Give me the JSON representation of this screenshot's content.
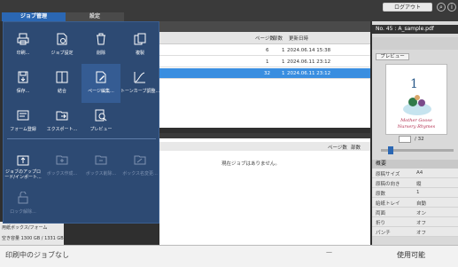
{
  "header": {
    "tabs": [
      {
        "label": "ジョブ管理"
      },
      {
        "label": "設定"
      }
    ],
    "logout_label": "ログアウト"
  },
  "job_list": {
    "columns": [
      "ページ数",
      "部数",
      "更新日時"
    ],
    "rows": [
      {
        "pages": "6",
        "copies": "1",
        "updated": "2024.06.14 15:38",
        "selected": false
      },
      {
        "pages": "1",
        "copies": "1",
        "updated": "2024.06.11 23:12",
        "selected": false
      },
      {
        "pages": "32",
        "copies": "1",
        "updated": "2024.06.11 23:12",
        "selected": true
      }
    ]
  },
  "queue": {
    "columns": [
      "ページ数",
      "部数"
    ],
    "empty_message": "現在ジョブはありません。"
  },
  "left_info": {
    "folder": "用紙ボックス/フォーム",
    "capacity": "空き容量 1300 GB / 1331 GB"
  },
  "preview": {
    "title": "No. 45 : A_sample.pdf",
    "preview_button": "プレビュー",
    "page_current": "",
    "page_total": "/ 32",
    "book_title_line1": "Mother Goose",
    "book_title_line2": "Nursery Rhymes",
    "book_page_no": "1"
  },
  "summary": {
    "header": "概要",
    "rows": [
      {
        "key": "原稿サイズ",
        "value": "A4"
      },
      {
        "key": "原稿の向き",
        "value": "縦"
      },
      {
        "key": "原数",
        "value": "1"
      },
      {
        "key": "給紙トレイ",
        "value": "自動"
      },
      {
        "key": "両面",
        "value": "オン"
      },
      {
        "key": "折り",
        "value": "オフ"
      },
      {
        "key": "パンチ",
        "value": "オフ"
      }
    ]
  },
  "menu": {
    "items": [
      {
        "label": "印刷...",
        "icon": "print-icon",
        "enabled": true
      },
      {
        "label": "ジョブ設定",
        "icon": "job-settings-icon",
        "enabled": true
      },
      {
        "label": "削除",
        "icon": "trash-icon",
        "enabled": true
      },
      {
        "label": "複製",
        "icon": "duplicate-icon",
        "enabled": true
      },
      {
        "label": "保存...",
        "icon": "save-icon",
        "enabled": true
      },
      {
        "label": "結合",
        "icon": "merge-icon",
        "enabled": true
      },
      {
        "label": "ページ編集...",
        "icon": "page-edit-icon",
        "enabled": true
      },
      {
        "label": "トーンカーブ調整...",
        "icon": "tone-curve-icon",
        "enabled": true
      },
      {
        "label": "フォーム登録",
        "icon": "form-register-icon",
        "enabled": true
      },
      {
        "label": "エクスポート...",
        "icon": "export-icon",
        "enabled": true
      },
      {
        "label": "プレビュー",
        "icon": "preview-icon",
        "enabled": true
      },
      {
        "label": "ジョブのアップロード/インポート...",
        "icon": "upload-import-icon",
        "enabled": true
      },
      {
        "label": "ボックス作成...",
        "icon": "box-create-icon",
        "enabled": false
      },
      {
        "label": "ボックス削除...",
        "icon": "box-delete-icon",
        "enabled": false
      },
      {
        "label": "ボックス名変更...",
        "icon": "box-rename-icon",
        "enabled": false
      },
      {
        "label": "ロック解除...",
        "icon": "unlock-icon",
        "enabled": false
      }
    ]
  },
  "status": {
    "left": "印刷中のジョブなし",
    "middle": "—",
    "right": "使用可能"
  },
  "colors": {
    "accent": "#2b67b3",
    "menu_bg": "#2d4a73",
    "selected_row": "#3a8ee0"
  }
}
